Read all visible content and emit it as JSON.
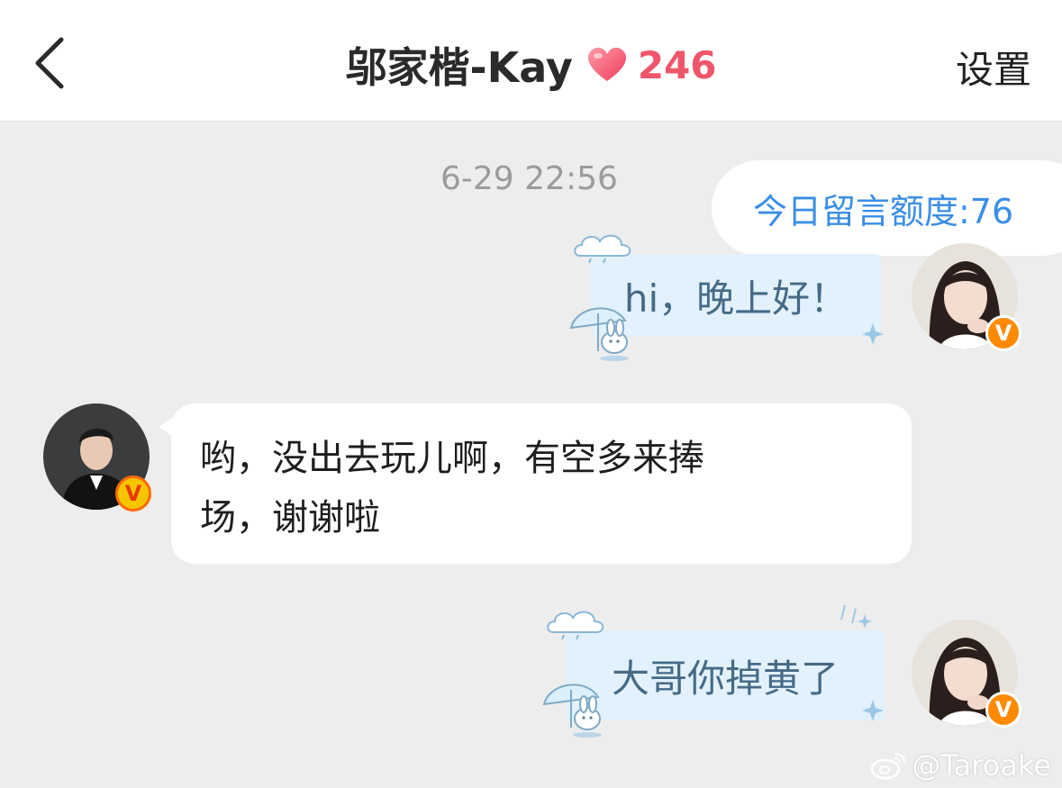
{
  "header": {
    "title": "邬家楷-Kay",
    "intimacy": "246",
    "settings_label": "设置"
  },
  "quota": {
    "label": "今日留言额度:76"
  },
  "messages": [
    {
      "time": "6-29 22:56"
    },
    {
      "side": "right",
      "text": "hi，晚上好！"
    },
    {
      "side": "left",
      "lines": [
        "哟，没出去玩儿啊，有空多来捧",
        "场，谢谢啦"
      ]
    },
    {
      "side": "right",
      "text": "大哥你掉黄了"
    }
  ],
  "badges": {
    "verified": "V"
  },
  "watermark": {
    "text": "@Taroake"
  },
  "colors": {
    "accent_blue": "#3a8ee6",
    "heart_pink": "#f0566b",
    "bubble_blue": "#e2f1fb",
    "badge_orange": "#ff8a00"
  },
  "icons": [
    "back-chevron-icon",
    "heart-icon",
    "cloud-icon",
    "umbrella-bunny-icon",
    "verified-badge-icon",
    "weibo-logo-icon"
  ]
}
